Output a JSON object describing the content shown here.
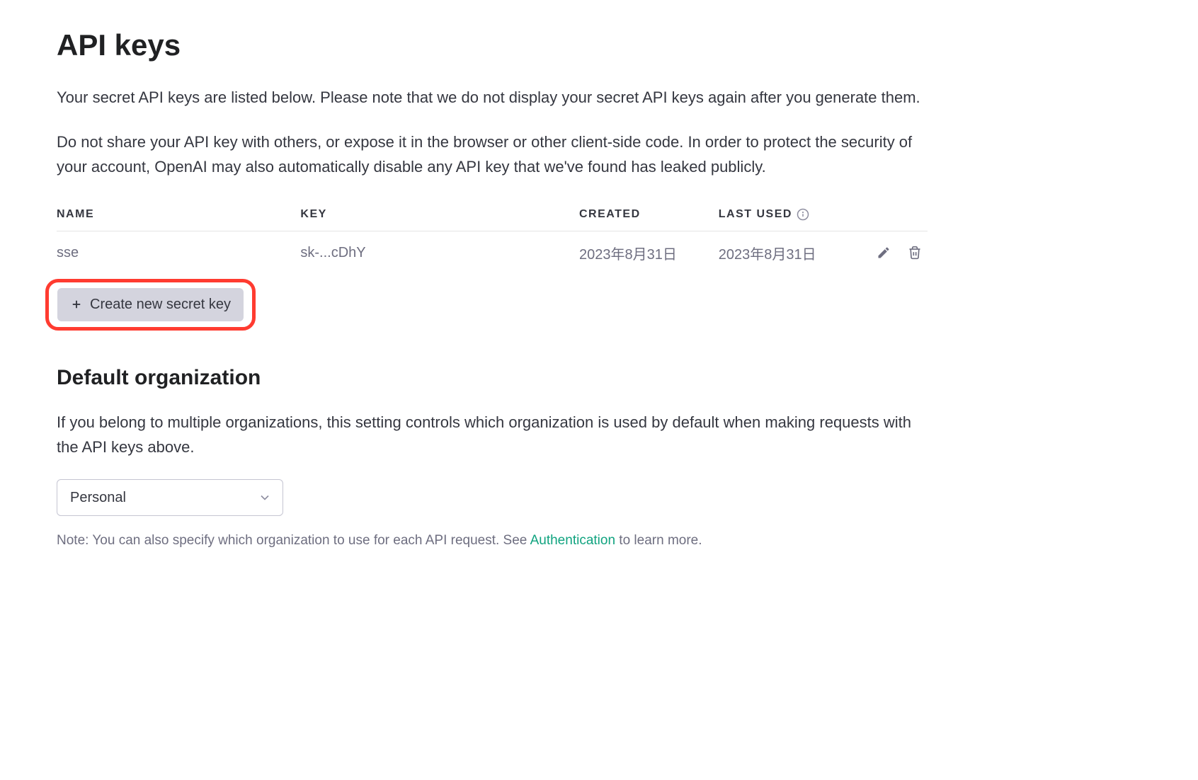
{
  "page": {
    "title": "API keys",
    "description1": "Your secret API keys are listed below. Please note that we do not display your secret API keys again after you generate them.",
    "description2": "Do not share your API key with others, or expose it in the browser or other client-side code. In order to protect the security of your account, OpenAI may also automatically disable any API key that we've found has leaked publicly."
  },
  "table": {
    "headers": {
      "name": "NAME",
      "key": "KEY",
      "created": "CREATED",
      "lastUsed": "LAST USED"
    },
    "rows": [
      {
        "name": "sse",
        "key": "sk-...cDhY",
        "created": "2023年8月31日",
        "lastUsed": "2023年8月31日"
      }
    ]
  },
  "createButton": {
    "label": "Create new secret key"
  },
  "defaultOrg": {
    "title": "Default organization",
    "description": "If you belong to multiple organizations, this setting controls which organization is used by default when making requests with the API keys above.",
    "selected": "Personal",
    "notePrefix": "Note: You can also specify which organization to use for each API request. See ",
    "noteLink": "Authentication",
    "noteSuffix": " to learn more."
  }
}
